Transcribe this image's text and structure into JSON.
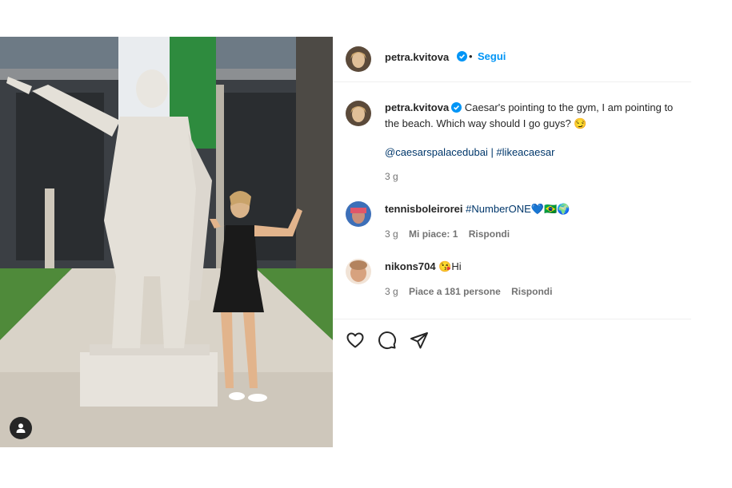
{
  "post": {
    "author": "petra.kvitova",
    "follow_label": "Segui",
    "dot": "•",
    "caption_text": "Caesar's pointing to the gym, I am pointing to the beach. Which way should I go guys? 😏",
    "caption_links": "@caesarspalacedubai | #likeacaesar",
    "caption_time": "3 g"
  },
  "comments": [
    {
      "user": "tennisboleirorei",
      "text": "#NumberONE💙🇧🇷🌍",
      "time": "3 g",
      "likes": "Mi piace: 1",
      "reply": "Rispondi"
    },
    {
      "user": "nikons704",
      "text": "😘Hi",
      "time": "3 g",
      "likes": "Piace a 181 persone",
      "reply": "Rispondi"
    }
  ],
  "icons": {
    "like": "heart-icon",
    "comment": "comment-bubble-icon",
    "share": "paper-plane-icon",
    "tags": "person-tag-icon",
    "verified": "verified-badge-icon"
  },
  "colors": {
    "link": "#00376b",
    "follow": "#0095f6",
    "verified": "#0095f6",
    "meta": "#737373"
  }
}
